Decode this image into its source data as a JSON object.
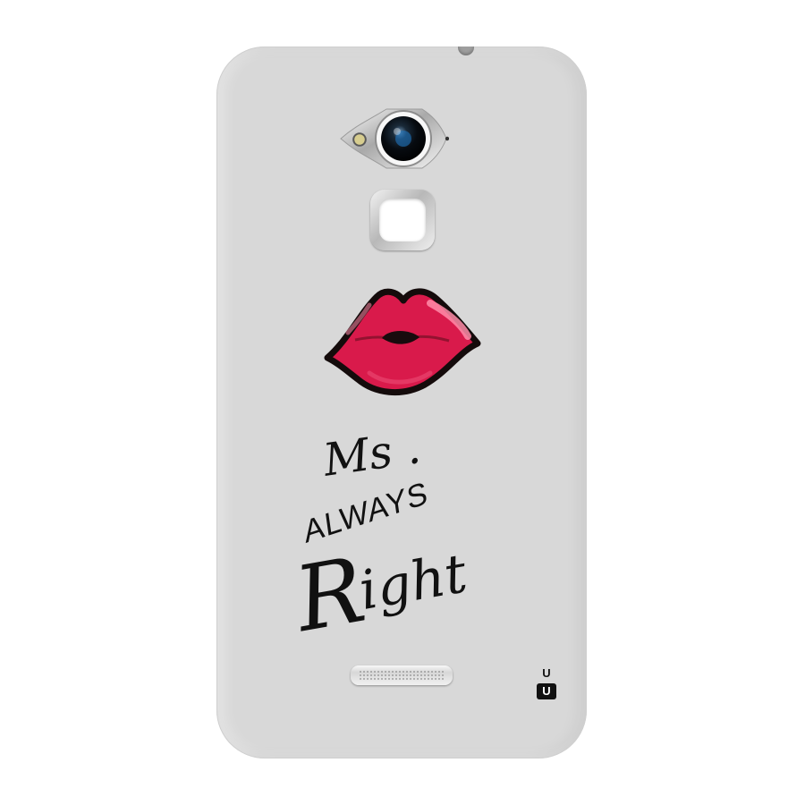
{
  "slogan": {
    "line1": "Ms .",
    "line2": "ALWAYS",
    "line3_initial": "R",
    "line3_rest": "ight"
  },
  "logo": {
    "top": "U",
    "bottom": "U"
  },
  "icons": {
    "camera": "camera-icon",
    "flash": "flash-icon",
    "fingerprint": "fingerprint-sensor-icon",
    "lips": "lips-icon",
    "speaker": "speaker-grill-icon",
    "logo": "brand-logo-icon"
  },
  "colors": {
    "case": "#d8d8d8",
    "lips": "#d91a4b",
    "text": "#111111"
  }
}
